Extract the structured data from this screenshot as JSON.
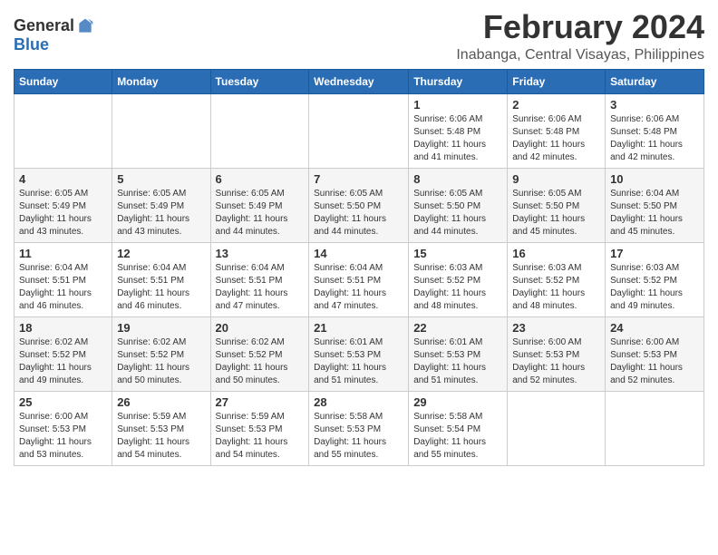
{
  "header": {
    "logo_general": "General",
    "logo_blue": "Blue",
    "month_title": "February 2024",
    "location": "Inabanga, Central Visayas, Philippines"
  },
  "days_of_week": [
    "Sunday",
    "Monday",
    "Tuesday",
    "Wednesday",
    "Thursday",
    "Friday",
    "Saturday"
  ],
  "weeks": [
    [
      {
        "day": "",
        "info": ""
      },
      {
        "day": "",
        "info": ""
      },
      {
        "day": "",
        "info": ""
      },
      {
        "day": "",
        "info": ""
      },
      {
        "day": "1",
        "info": "Sunrise: 6:06 AM\nSunset: 5:48 PM\nDaylight: 11 hours and 41 minutes."
      },
      {
        "day": "2",
        "info": "Sunrise: 6:06 AM\nSunset: 5:48 PM\nDaylight: 11 hours and 42 minutes."
      },
      {
        "day": "3",
        "info": "Sunrise: 6:06 AM\nSunset: 5:48 PM\nDaylight: 11 hours and 42 minutes."
      }
    ],
    [
      {
        "day": "4",
        "info": "Sunrise: 6:05 AM\nSunset: 5:49 PM\nDaylight: 11 hours and 43 minutes."
      },
      {
        "day": "5",
        "info": "Sunrise: 6:05 AM\nSunset: 5:49 PM\nDaylight: 11 hours and 43 minutes."
      },
      {
        "day": "6",
        "info": "Sunrise: 6:05 AM\nSunset: 5:49 PM\nDaylight: 11 hours and 44 minutes."
      },
      {
        "day": "7",
        "info": "Sunrise: 6:05 AM\nSunset: 5:50 PM\nDaylight: 11 hours and 44 minutes."
      },
      {
        "day": "8",
        "info": "Sunrise: 6:05 AM\nSunset: 5:50 PM\nDaylight: 11 hours and 44 minutes."
      },
      {
        "day": "9",
        "info": "Sunrise: 6:05 AM\nSunset: 5:50 PM\nDaylight: 11 hours and 45 minutes."
      },
      {
        "day": "10",
        "info": "Sunrise: 6:04 AM\nSunset: 5:50 PM\nDaylight: 11 hours and 45 minutes."
      }
    ],
    [
      {
        "day": "11",
        "info": "Sunrise: 6:04 AM\nSunset: 5:51 PM\nDaylight: 11 hours and 46 minutes."
      },
      {
        "day": "12",
        "info": "Sunrise: 6:04 AM\nSunset: 5:51 PM\nDaylight: 11 hours and 46 minutes."
      },
      {
        "day": "13",
        "info": "Sunrise: 6:04 AM\nSunset: 5:51 PM\nDaylight: 11 hours and 47 minutes."
      },
      {
        "day": "14",
        "info": "Sunrise: 6:04 AM\nSunset: 5:51 PM\nDaylight: 11 hours and 47 minutes."
      },
      {
        "day": "15",
        "info": "Sunrise: 6:03 AM\nSunset: 5:52 PM\nDaylight: 11 hours and 48 minutes."
      },
      {
        "day": "16",
        "info": "Sunrise: 6:03 AM\nSunset: 5:52 PM\nDaylight: 11 hours and 48 minutes."
      },
      {
        "day": "17",
        "info": "Sunrise: 6:03 AM\nSunset: 5:52 PM\nDaylight: 11 hours and 49 minutes."
      }
    ],
    [
      {
        "day": "18",
        "info": "Sunrise: 6:02 AM\nSunset: 5:52 PM\nDaylight: 11 hours and 49 minutes."
      },
      {
        "day": "19",
        "info": "Sunrise: 6:02 AM\nSunset: 5:52 PM\nDaylight: 11 hours and 50 minutes."
      },
      {
        "day": "20",
        "info": "Sunrise: 6:02 AM\nSunset: 5:52 PM\nDaylight: 11 hours and 50 minutes."
      },
      {
        "day": "21",
        "info": "Sunrise: 6:01 AM\nSunset: 5:53 PM\nDaylight: 11 hours and 51 minutes."
      },
      {
        "day": "22",
        "info": "Sunrise: 6:01 AM\nSunset: 5:53 PM\nDaylight: 11 hours and 51 minutes."
      },
      {
        "day": "23",
        "info": "Sunrise: 6:00 AM\nSunset: 5:53 PM\nDaylight: 11 hours and 52 minutes."
      },
      {
        "day": "24",
        "info": "Sunrise: 6:00 AM\nSunset: 5:53 PM\nDaylight: 11 hours and 52 minutes."
      }
    ],
    [
      {
        "day": "25",
        "info": "Sunrise: 6:00 AM\nSunset: 5:53 PM\nDaylight: 11 hours and 53 minutes."
      },
      {
        "day": "26",
        "info": "Sunrise: 5:59 AM\nSunset: 5:53 PM\nDaylight: 11 hours and 54 minutes."
      },
      {
        "day": "27",
        "info": "Sunrise: 5:59 AM\nSunset: 5:53 PM\nDaylight: 11 hours and 54 minutes."
      },
      {
        "day": "28",
        "info": "Sunrise: 5:58 AM\nSunset: 5:53 PM\nDaylight: 11 hours and 55 minutes."
      },
      {
        "day": "29",
        "info": "Sunrise: 5:58 AM\nSunset: 5:54 PM\nDaylight: 11 hours and 55 minutes."
      },
      {
        "day": "",
        "info": ""
      },
      {
        "day": "",
        "info": ""
      }
    ]
  ]
}
